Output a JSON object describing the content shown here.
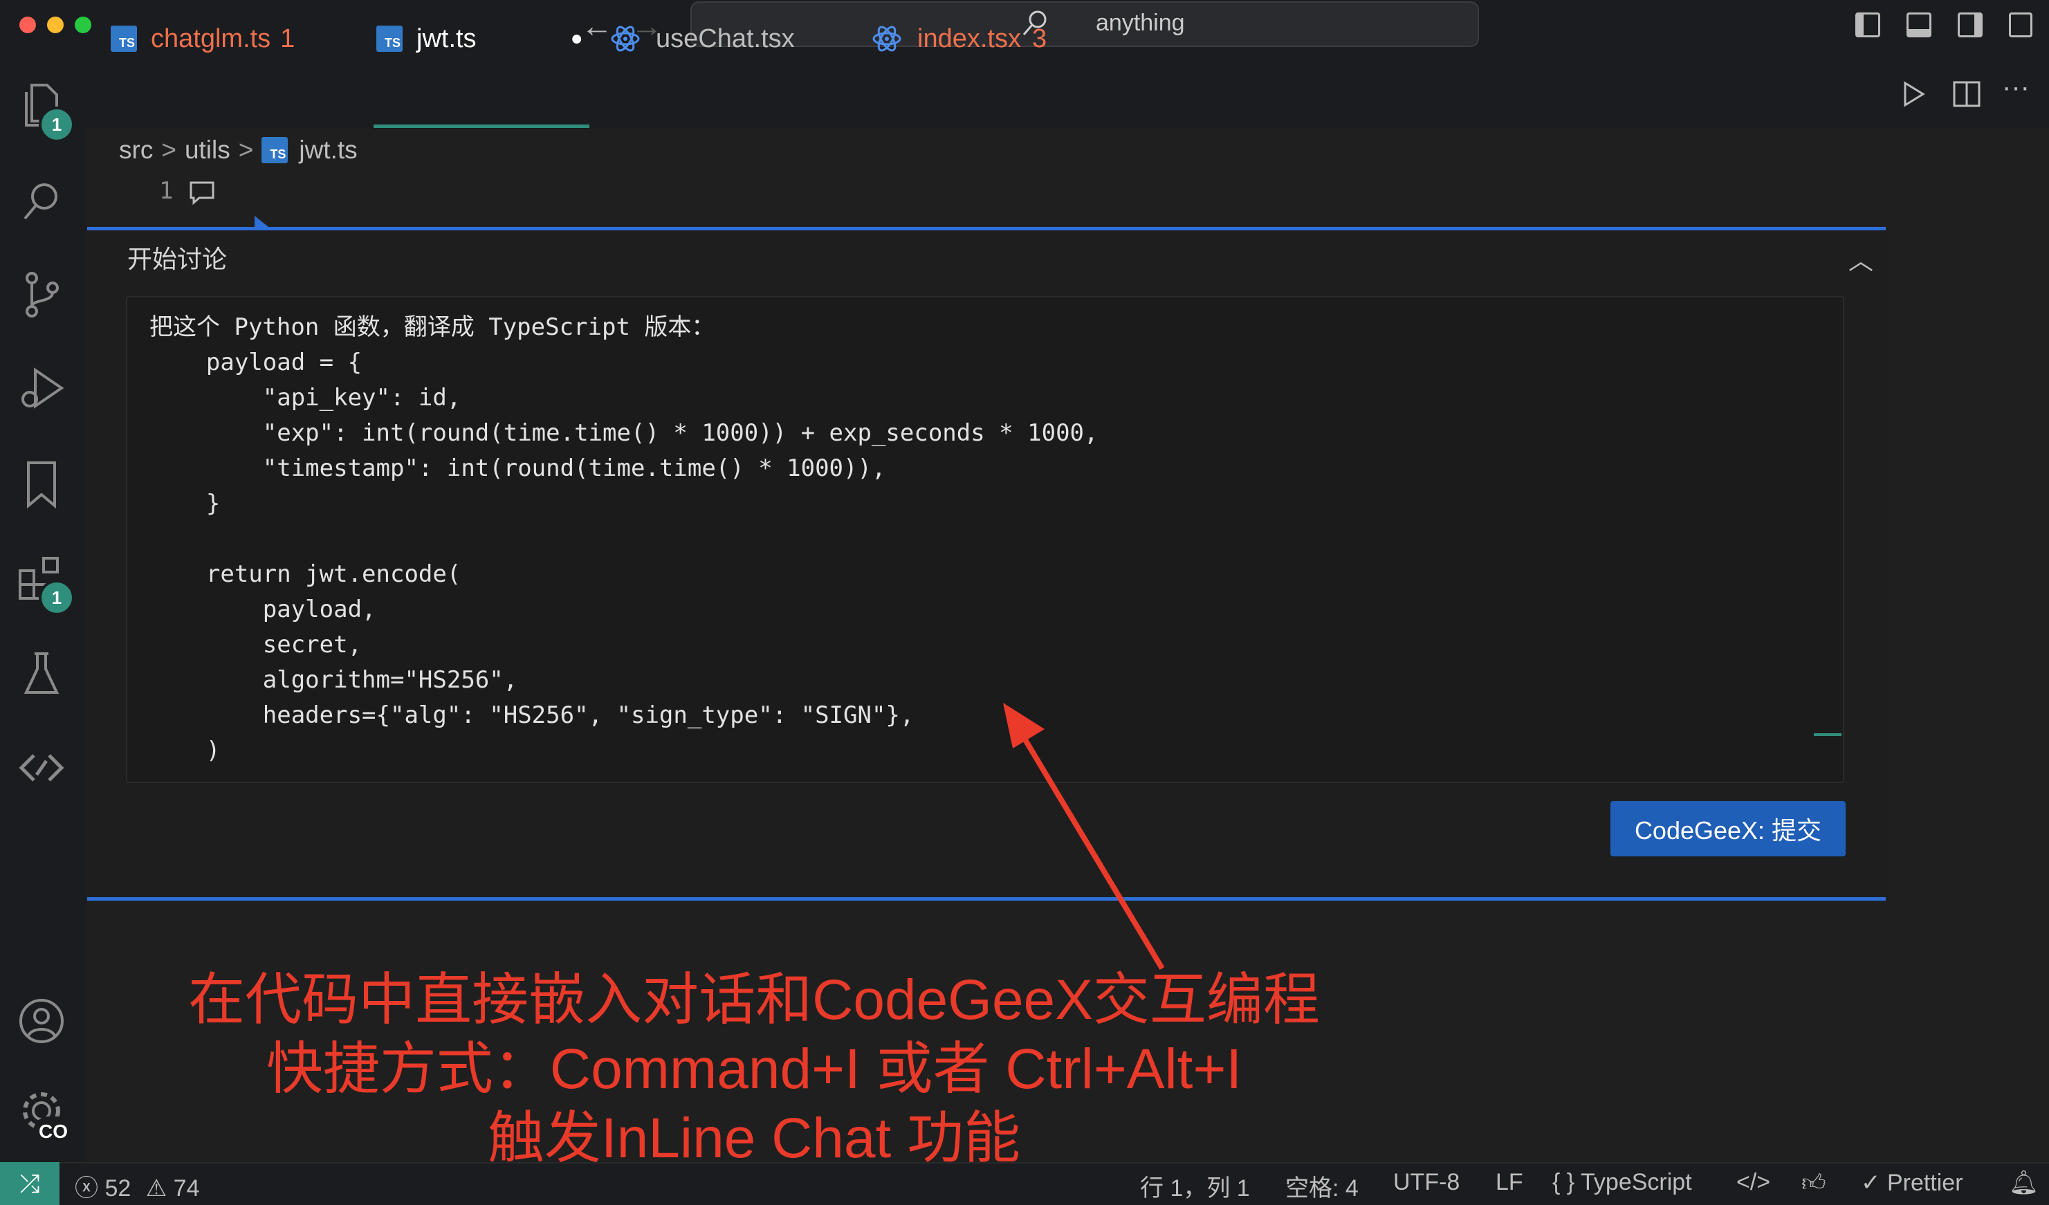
{
  "search": {
    "text": "anything"
  },
  "activity": {
    "explorer_badge": "1",
    "extensions_badge": "1",
    "settings_badge": "CO"
  },
  "tabs": [
    {
      "label": "chatglm.ts",
      "count": "1",
      "icon": "ts"
    },
    {
      "label": "jwt.ts",
      "icon": "ts",
      "modified": "●"
    },
    {
      "label": "useChat.tsx",
      "icon": "react"
    },
    {
      "label": "index.tsx",
      "count": "3",
      "icon": "react"
    }
  ],
  "breadcrumb": {
    "parts": [
      "src",
      "utils"
    ],
    "file": "jwt.ts",
    "sep": ">"
  },
  "editor": {
    "line_number": "1"
  },
  "inline_chat": {
    "title": "开始讨论",
    "collapse": "︿",
    "input_text": "把这个 Python 函数，翻译成 TypeScript 版本：\n    payload = {\n        \"api_key\": id,\n        \"exp\": int(round(time.time() * 1000)) + exp_seconds * 1000,\n        \"timestamp\": int(round(time.time() * 1000)),\n    }\n\n    return jwt.encode(\n        payload,\n        secret,\n        algorithm=\"HS256\",\n        headers={\"alg\": \"HS256\", \"sign_type\": \"SIGN\"},\n    )",
    "submit_label": "CodeGeeX: 提交"
  },
  "annotation": {
    "line1": "在代码中直接嵌入对话和CodeGeeX交互编程",
    "line2": "快捷方式：Command+I 或者 Ctrl+Alt+I",
    "line3": "触发InLine Chat 功能"
  },
  "status": {
    "errors": "52",
    "warnings": "74",
    "position": "行 1，列 1",
    "spaces": "空格: 4",
    "encoding": "UTF-8",
    "eol": "LF",
    "language": "TypeScript",
    "formatter": "Prettier"
  },
  "colors": {
    "accent": "#2e6fd9",
    "teal": "#2f8e7c",
    "annotation": "#ea3a2a",
    "error_tab": "#f0704c"
  }
}
